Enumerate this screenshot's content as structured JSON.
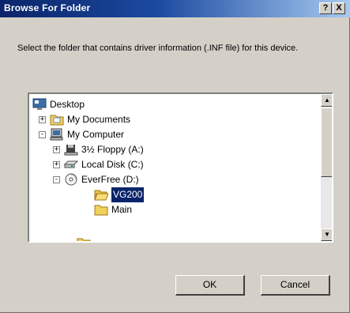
{
  "window": {
    "title": "Browse For Folder",
    "help_label": "?",
    "close_label": "X"
  },
  "instruction": "Select the folder that contains driver information (.INF file) for this device.",
  "tree": {
    "expanded_glyph": "-",
    "collapsed_glyph": "+",
    "items": [
      {
        "label": "Desktop",
        "icon": "desktop-icon"
      },
      {
        "label": "My Documents",
        "icon": "folder-documents-icon",
        "expander": "+"
      },
      {
        "label": "My Computer",
        "icon": "computer-icon",
        "expander": "-"
      },
      {
        "label": "3½ Floppy (A:)",
        "icon": "floppy-icon",
        "expander": "+"
      },
      {
        "label": "Local Disk (C:)",
        "icon": "hard-disk-icon",
        "expander": "+"
      },
      {
        "label": "EverFree (D:)",
        "icon": "cd-drive-icon",
        "expander": "-"
      },
      {
        "label": "VG200",
        "icon": "folder-open-icon",
        "selected": true
      },
      {
        "label": "Main",
        "icon": "folder-icon"
      }
    ]
  },
  "scrollbar": {
    "up": "▲",
    "down": "▼"
  },
  "buttons": {
    "ok": "OK",
    "cancel": "Cancel"
  },
  "colors": {
    "title_start": "#0a246a",
    "title_end": "#a6caf0",
    "face": "#d4d0c8",
    "selection": "#0a246a",
    "folder": "#f2d15a"
  }
}
